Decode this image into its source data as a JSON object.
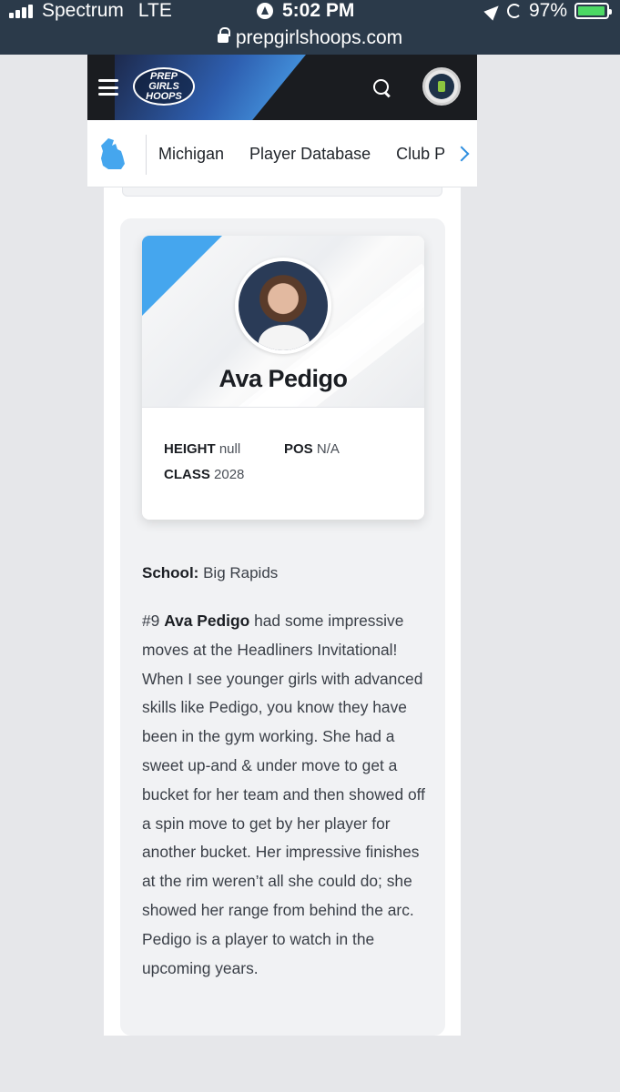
{
  "status_bar": {
    "carrier": "Spectrum",
    "network": "LTE",
    "time": "5:02 PM",
    "battery": "97%",
    "battery_level": 0.97
  },
  "url_bar": {
    "domain": "prepgirlshoops.com"
  },
  "header": {
    "logo_lines": [
      "PREP",
      "GIRLS",
      "HOOPS"
    ],
    "menu_icon": "hamburger-icon",
    "search_icon": "search-icon",
    "badge_icon": "state-badge-icon",
    "accent_color": "#45a6ee"
  },
  "sub_nav": {
    "state_icon": "michigan-icon",
    "items": [
      "Michigan",
      "Player Database",
      "Club P"
    ],
    "scroll_icon": "chevron-right-icon"
  },
  "player": {
    "name": "Ava Pedigo",
    "height_label": "HEIGHT",
    "height_value": "null",
    "pos_label": "POS",
    "pos_value": "N/A",
    "class_label": "CLASS",
    "class_value": "2028"
  },
  "article": {
    "school_label": "School:",
    "school_value": "Big Rapids",
    "number": "#9",
    "bold_name": "Ava Pedigo",
    "body": "had some impressive moves at the Headliners Invitational! When I see younger girls with advanced skills like Pedigo, you know they have been in the gym working. She had a sweet up-and & under move to get a bucket for her team and then showed off a spin move to get by her player for another bucket. Her impressive finishes at the rim weren’t all she could do; she showed her range from behind the arc. Pedigo is a player to watch in the upcoming years."
  }
}
